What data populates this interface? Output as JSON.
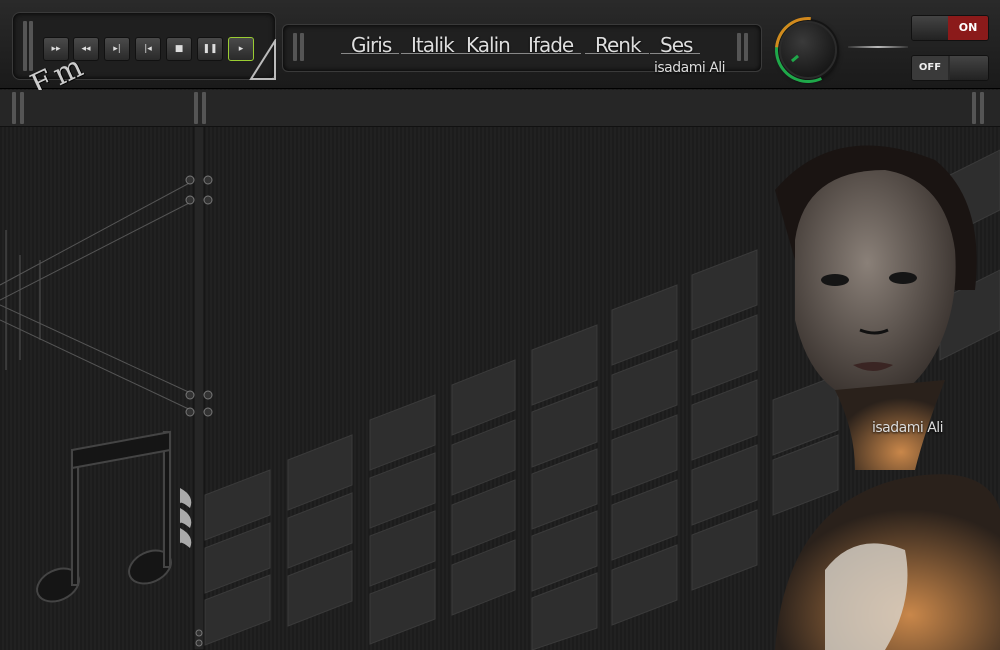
{
  "menu": {
    "items": [
      {
        "label": "Giris"
      },
      {
        "label": "Italik"
      },
      {
        "label": "Kalin"
      },
      {
        "label": "Ifade"
      },
      {
        "label": "Renk"
      },
      {
        "label": "Ses"
      }
    ]
  },
  "signature": "isadami Ali",
  "portrait_signature": "isadami Ali",
  "logo_text": "Fm",
  "transport": {
    "buttons": [
      {
        "name": "fast-forward",
        "glyph": "▸▸"
      },
      {
        "name": "rewind",
        "glyph": "◂◂"
      },
      {
        "name": "next-track",
        "glyph": "▸|"
      },
      {
        "name": "previous-track",
        "glyph": "|◂"
      },
      {
        "name": "stop",
        "glyph": "■"
      },
      {
        "name": "pause",
        "glyph": "❚❚"
      },
      {
        "name": "play",
        "glyph": "▸"
      }
    ]
  },
  "switches": {
    "on_label": "ON",
    "off_label": "OFF"
  },
  "colors": {
    "on_switch": "#8b1a1a",
    "knob_green": "#1fa84a",
    "knob_orange": "#d2891d",
    "play_border": "#9acd32"
  }
}
